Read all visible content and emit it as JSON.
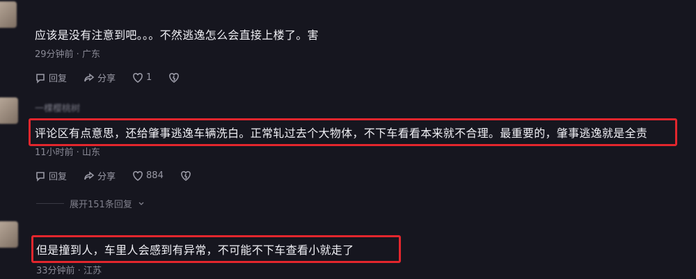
{
  "comments": [
    {
      "text": "应该是没有注意到吧。。。不然逃逸怎么会直接上楼了。害",
      "time": "29分钟前",
      "location": "广东",
      "reply_label": "回复",
      "share_label": "分享",
      "like_count": "1"
    },
    {
      "username": "一棵樱桃树",
      "text": "评论区有点意思，还给肇事逃逸车辆洗白。正常轧过去个大物体，不下车看看本来就不合理。最重要的，肇事逃逸就是全责",
      "time": "11小时前",
      "location": "山东",
      "reply_label": "回复",
      "share_label": "分享",
      "like_count": "884",
      "expand_replies": "展开151条回复"
    },
    {
      "text": "但是撞到人，车里人会感到有异常，不可能不下车查看小就走了",
      "time": "33分钟前",
      "location": "江苏"
    }
  ],
  "colors": {
    "highlight_border": "#e3262d",
    "background": "#16161f"
  }
}
